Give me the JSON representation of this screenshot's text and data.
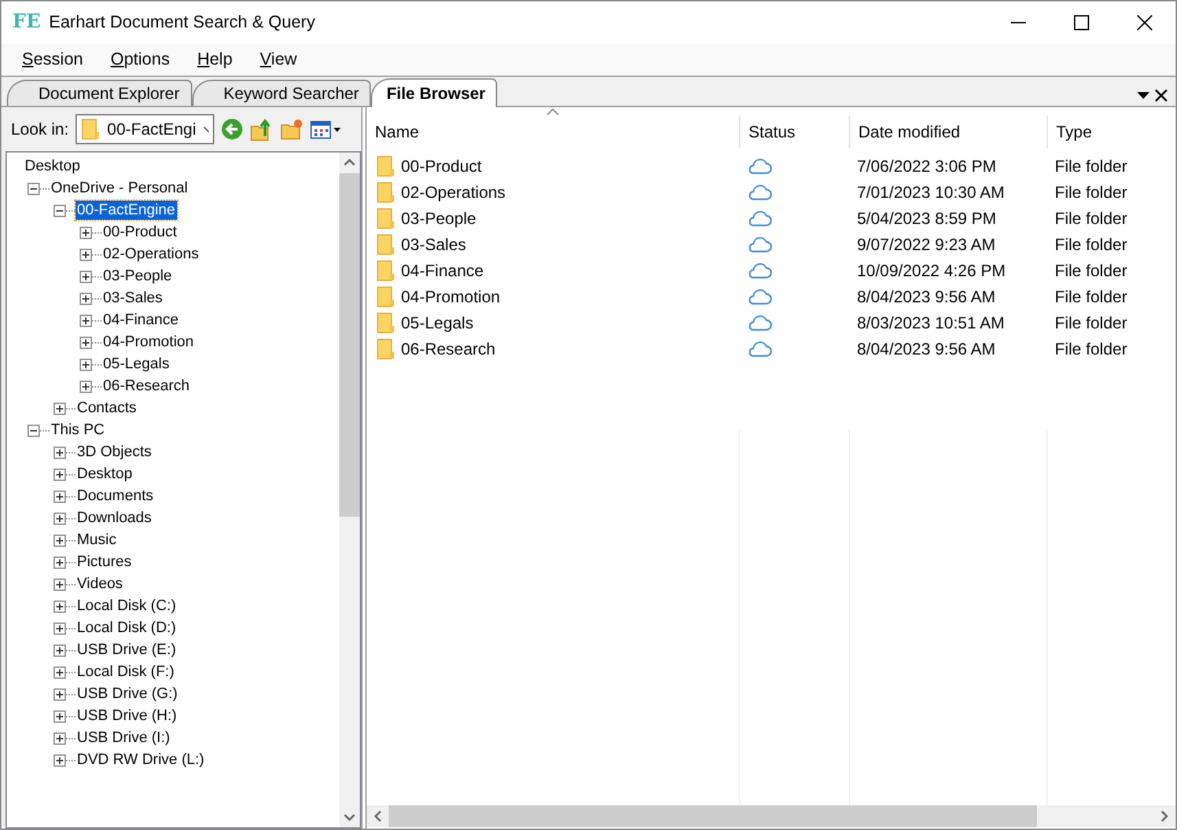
{
  "window": {
    "logo": "FE",
    "title": "Earhart Document Search & Query"
  },
  "menu": [
    "Session",
    "Options",
    "Help",
    "View"
  ],
  "tabs": [
    {
      "label": "Document Explorer",
      "selected": false
    },
    {
      "label": "Keyword Searcher",
      "selected": false
    },
    {
      "label": "File Browser",
      "selected": true
    }
  ],
  "look_in": {
    "label": "Look in:",
    "value": "00-FactEngi"
  },
  "tree": [
    {
      "label": "Desktop",
      "selected": false,
      "children": [
        {
          "label": "OneDrive - Personal",
          "expanded": true,
          "selected": false,
          "children": [
            {
              "label": "00-FactEngine",
              "expanded": true,
              "selected": true,
              "children": [
                {
                  "label": "00-Product",
                  "expanded": false,
                  "selected": false
                },
                {
                  "label": "02-Operations",
                  "expanded": false,
                  "selected": false
                },
                {
                  "label": "03-People",
                  "expanded": false,
                  "selected": false
                },
                {
                  "label": "03-Sales",
                  "expanded": false,
                  "selected": false
                },
                {
                  "label": "04-Finance",
                  "expanded": false,
                  "selected": false
                },
                {
                  "label": "04-Promotion",
                  "expanded": false,
                  "selected": false
                },
                {
                  "label": "05-Legals",
                  "expanded": false,
                  "selected": false
                },
                {
                  "label": "06-Research",
                  "expanded": false,
                  "selected": false
                }
              ]
            },
            {
              "label": "Contacts",
              "expanded": false,
              "selected": false
            }
          ]
        },
        {
          "label": "This PC",
          "expanded": true,
          "selected": false,
          "children": [
            {
              "label": "3D Objects",
              "expanded": false,
              "selected": false
            },
            {
              "label": "Desktop",
              "expanded": false,
              "selected": false
            },
            {
              "label": "Documents",
              "expanded": false,
              "selected": false
            },
            {
              "label": "Downloads",
              "expanded": false,
              "selected": false
            },
            {
              "label": "Music",
              "expanded": false,
              "selected": false
            },
            {
              "label": "Pictures",
              "expanded": false,
              "selected": false
            },
            {
              "label": "Videos",
              "expanded": false,
              "selected": false
            },
            {
              "label": "Local Disk (C:)",
              "expanded": false,
              "selected": false
            },
            {
              "label": "Local Disk (D:)",
              "expanded": false,
              "selected": false
            },
            {
              "label": "USB Drive (E:)",
              "expanded": false,
              "selected": false
            },
            {
              "label": "Local Disk (F:)",
              "expanded": false,
              "selected": false
            },
            {
              "label": "USB Drive (G:)",
              "expanded": false,
              "selected": false
            },
            {
              "label": "USB Drive (H:)",
              "expanded": false,
              "selected": false
            },
            {
              "label": "USB Drive (I:)",
              "expanded": false,
              "selected": false
            },
            {
              "label": "DVD RW Drive (L:)",
              "expanded": false,
              "selected": false
            }
          ]
        }
      ]
    }
  ],
  "files": {
    "columns": [
      "Name",
      "Status",
      "Date modified",
      "Type"
    ],
    "rows": [
      {
        "name": "00-Product",
        "date": "7/06/2022 3:06 PM",
        "type": "File folder"
      },
      {
        "name": "02-Operations",
        "date": "7/01/2023 10:30 AM",
        "type": "File folder"
      },
      {
        "name": "03-People",
        "date": "5/04/2023 8:59 PM",
        "type": "File folder"
      },
      {
        "name": "03-Sales",
        "date": "9/07/2022 9:23 AM",
        "type": "File folder"
      },
      {
        "name": "04-Finance",
        "date": "10/09/2022 4:26 PM",
        "type": "File folder"
      },
      {
        "name": "04-Promotion",
        "date": "8/04/2023 9:56 AM",
        "type": "File folder"
      },
      {
        "name": "05-Legals",
        "date": "8/03/2023 10:51 AM",
        "type": "File folder"
      },
      {
        "name": "06-Research",
        "date": "8/04/2023 9:56 AM",
        "type": "File folder"
      }
    ]
  }
}
